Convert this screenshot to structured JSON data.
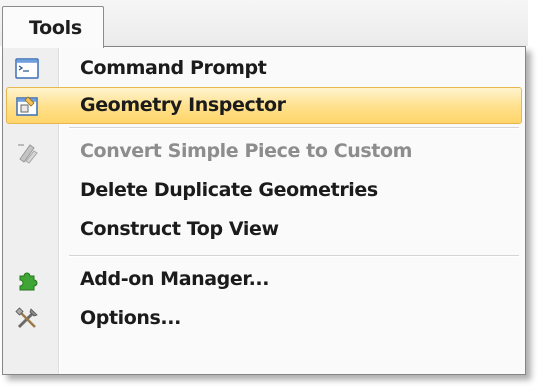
{
  "menubar": {
    "tab_label": "Tools"
  },
  "menu": {
    "items": [
      {
        "label": "Command Prompt",
        "icon": "command-prompt-icon",
        "enabled": true,
        "highlighted": false
      },
      {
        "label": "Geometry Inspector",
        "icon": "geometry-inspector-icon",
        "enabled": true,
        "highlighted": true
      },
      {
        "label": "Convert Simple Piece to Custom",
        "icon": "convert-piece-icon",
        "enabled": false,
        "highlighted": false
      },
      {
        "label": "Delete Duplicate Geometries",
        "icon": "",
        "enabled": true,
        "highlighted": false
      },
      {
        "label": "Construct Top View",
        "icon": "",
        "enabled": true,
        "highlighted": false
      },
      {
        "label": "Add-on Manager...",
        "icon": "puzzle-piece-icon",
        "enabled": true,
        "highlighted": false
      },
      {
        "label": "Options...",
        "icon": "tools-icon",
        "enabled": true,
        "highlighted": false
      }
    ]
  },
  "colors": {
    "highlight_top": "#fff4cf",
    "highlight_bottom": "#ffd56a",
    "highlight_border": "#e7b851",
    "disabled_text": "#8d8d8d",
    "puzzle_green": "#3fa535"
  }
}
